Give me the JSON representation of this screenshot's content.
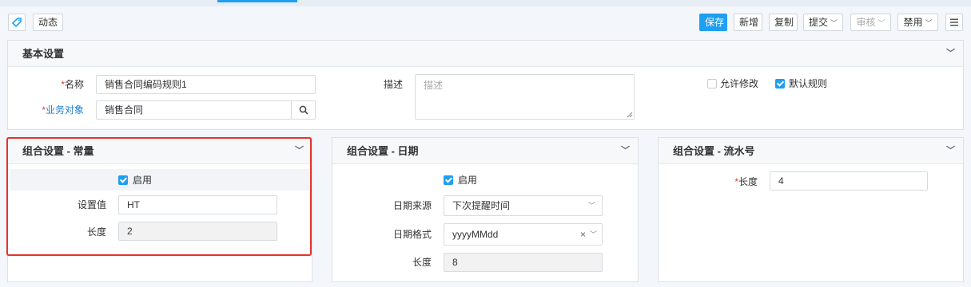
{
  "toolbar": {
    "activity_label": "动态",
    "save_label": "保存",
    "new_label": "新增",
    "copy_label": "复制",
    "submit_label": "提交",
    "review_label": "审核",
    "disable_label": "禁用"
  },
  "basic": {
    "title": "基本设置",
    "name_label": "名称",
    "name_value": "销售合同编码规则1",
    "object_label": "业务对象",
    "object_value": "销售合同",
    "desc_label": "描述",
    "desc_placeholder": "描述",
    "allow_edit_label": "允许修改",
    "allow_edit_checked": false,
    "default_rule_label": "默认规则",
    "default_rule_checked": true
  },
  "constant": {
    "title": "组合设置 - 常量",
    "enabled_label": "启用",
    "enabled": true,
    "value_label": "设置值",
    "value": "HT",
    "length_label": "长度",
    "length": "2"
  },
  "date": {
    "title": "组合设置 - 日期",
    "enabled_label": "启用",
    "enabled": true,
    "source_label": "日期来源",
    "source_value": "下次提醒时间",
    "format_label": "日期格式",
    "format_value": "yyyyMMdd",
    "length_label": "长度",
    "length": "8"
  },
  "serial": {
    "title": "组合设置 - 流水号",
    "length_label": "长度",
    "length": "4"
  },
  "colors": {
    "accent": "#1e9ff2",
    "required": "#e23d3d",
    "highlight": "#e5322d"
  }
}
